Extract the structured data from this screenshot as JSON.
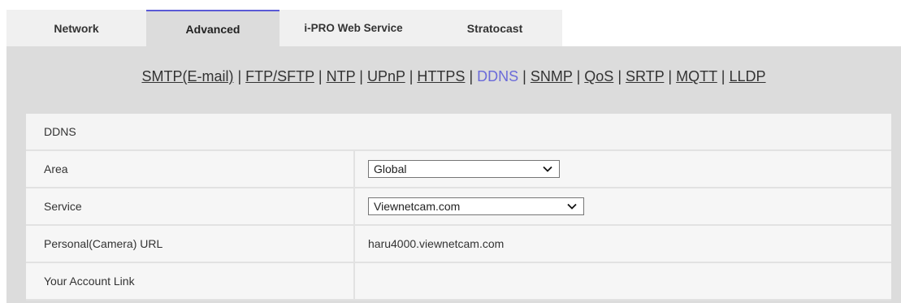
{
  "tabs": [
    "Network",
    "Advanced",
    "i-PRO Web Service",
    "Stratocast"
  ],
  "active_tab": "Advanced",
  "subnav": [
    {
      "label": "SMTP(E-mail)"
    },
    {
      "label": "FTP/SFTP"
    },
    {
      "label": "NTP"
    },
    {
      "label": "UPnP"
    },
    {
      "label": "HTTPS"
    },
    {
      "label": "DDNS",
      "active": true
    },
    {
      "label": "SNMP"
    },
    {
      "label": "QoS"
    },
    {
      "label": "SRTP"
    },
    {
      "label": "MQTT"
    },
    {
      "label": "LLDP"
    }
  ],
  "subnav_separator": "|",
  "section": {
    "title": "DDNS"
  },
  "rows": {
    "area": {
      "label": "Area",
      "value": "Global"
    },
    "service": {
      "label": "Service",
      "value": "Viewnetcam.com"
    },
    "url": {
      "label": "Personal(Camera) URL",
      "value": "haru4000.viewnetcam.com"
    },
    "account": {
      "label": "Your Account Link",
      "value": ""
    }
  },
  "colors": {
    "accent": "#6b6bd9",
    "panel_bg": "#dcdcdc",
    "row_bg": "#f6f6f6"
  }
}
